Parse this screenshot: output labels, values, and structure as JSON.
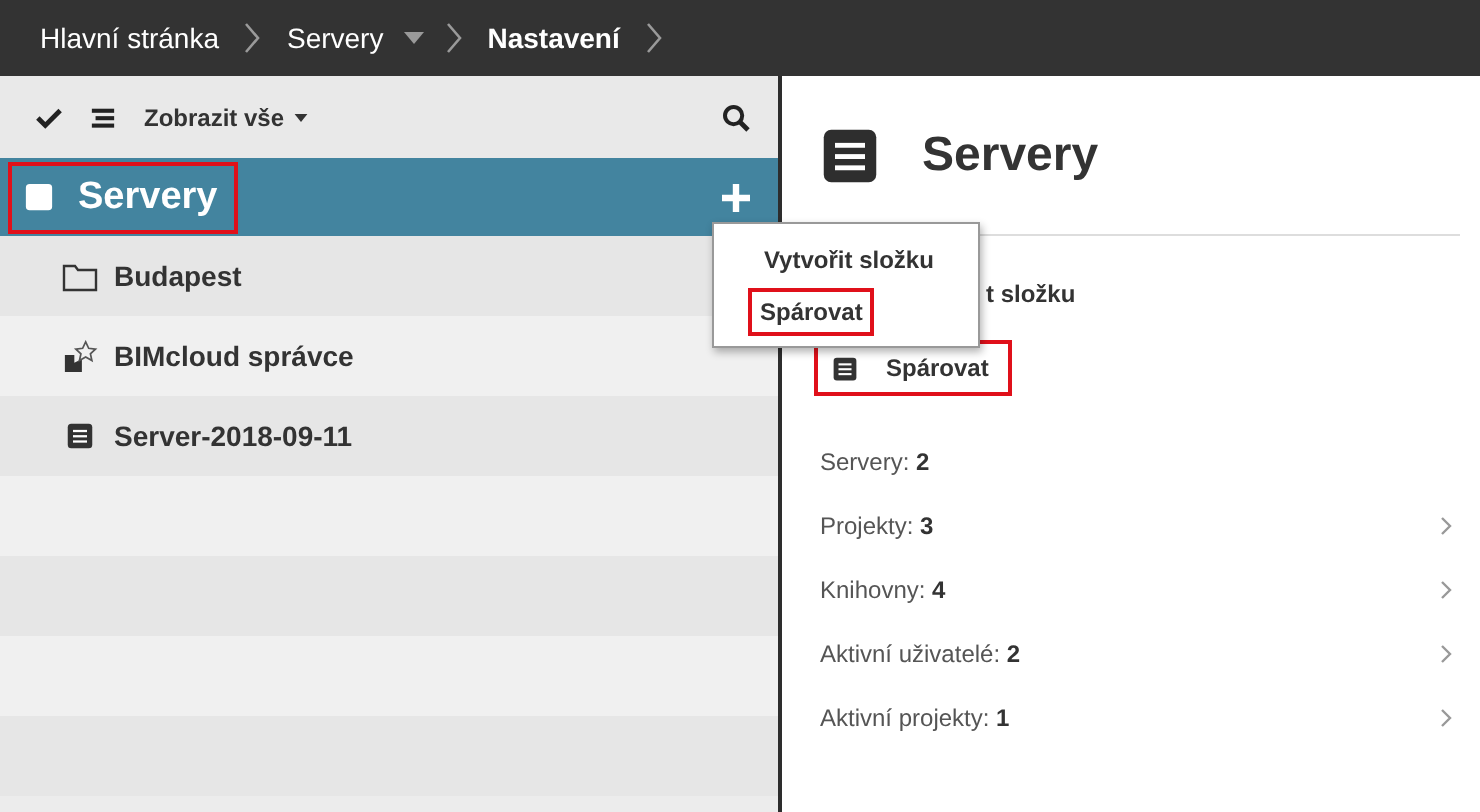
{
  "breadcrumbs": [
    {
      "label": "Hlavní stránka",
      "current": false,
      "dropdown": false
    },
    {
      "label": "Servery",
      "current": false,
      "dropdown": true
    },
    {
      "label": "Nastavení",
      "current": true,
      "dropdown": false
    }
  ],
  "toolbar": {
    "filter": "Zobrazit vše"
  },
  "tree": {
    "root": {
      "label": "Servery",
      "selected": true,
      "highlighted": true
    },
    "items": [
      {
        "kind": "folder",
        "label": "Budapest",
        "selected": false
      },
      {
        "kind": "manager",
        "label": "BIMcloud správce",
        "selected": false
      },
      {
        "kind": "server",
        "label": "Server-2018-09-11",
        "selected": false
      }
    ]
  },
  "add_menu": {
    "items": [
      {
        "label": "Vytvořit složku",
        "highlighted": false
      },
      {
        "label": "Spárovat",
        "highlighted": true
      }
    ]
  },
  "detail": {
    "title": "Servery",
    "actions": [
      {
        "kind": "partial",
        "label": "t složku"
      },
      {
        "kind": "server",
        "label": "Spárovat",
        "highlighted": true
      }
    ],
    "stats": [
      {
        "label": "Servery:",
        "value": "2",
        "link": false
      },
      {
        "label": "Projekty:",
        "value": "3",
        "link": true
      },
      {
        "label": "Knihovny:",
        "value": "4",
        "link": true
      },
      {
        "label": "Aktivní uživatelé:",
        "value": "2",
        "link": true
      },
      {
        "label": "Aktivní projekty:",
        "value": "1",
        "link": true
      }
    ]
  }
}
